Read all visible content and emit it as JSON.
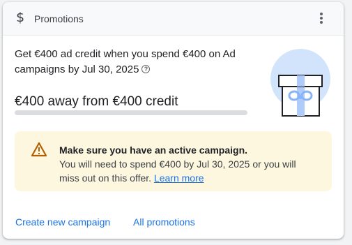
{
  "header": {
    "icon": "dollar-icon",
    "title": "Promotions",
    "more_icon": "more-vert-icon"
  },
  "offer": {
    "title": "Get €400 ad credit when you spend €400 on Ad campaigns by Jul 30, 2025",
    "help_icon": "help-icon",
    "progress_text": "€400 away from €400 credit",
    "progress_fraction": 0
  },
  "notice": {
    "icon": "warning-icon",
    "title": "Make sure you have an active campaign.",
    "body": "You will need to spend €400 by Jul 30, 2025 or you will miss out on this offer.",
    "link": "Learn more"
  },
  "footer": {
    "create_campaign": "Create new campaign",
    "all_promotions": "All promotions"
  },
  "colors": {
    "link": "#1a73e8",
    "notice_bg": "#fef7e0",
    "warning": "#b06000",
    "illustration": "#d2e3fc"
  }
}
